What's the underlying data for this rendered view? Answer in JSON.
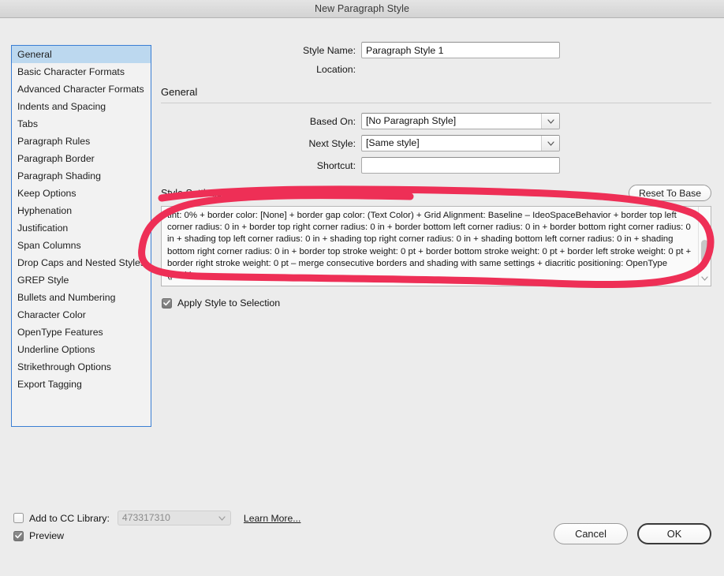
{
  "window": {
    "title": "New Paragraph Style"
  },
  "sidebar": {
    "items": [
      {
        "label": "General",
        "selected": true
      },
      {
        "label": "Basic Character Formats",
        "selected": false
      },
      {
        "label": "Advanced Character Formats",
        "selected": false
      },
      {
        "label": "Indents and Spacing",
        "selected": false
      },
      {
        "label": "Tabs",
        "selected": false
      },
      {
        "label": "Paragraph Rules",
        "selected": false
      },
      {
        "label": "Paragraph Border",
        "selected": false
      },
      {
        "label": "Paragraph Shading",
        "selected": false
      },
      {
        "label": "Keep Options",
        "selected": false
      },
      {
        "label": "Hyphenation",
        "selected": false
      },
      {
        "label": "Justification",
        "selected": false
      },
      {
        "label": "Span Columns",
        "selected": false
      },
      {
        "label": "Drop Caps and Nested Styles",
        "selected": false
      },
      {
        "label": "GREP Style",
        "selected": false
      },
      {
        "label": "Bullets and Numbering",
        "selected": false
      },
      {
        "label": "Character Color",
        "selected": false
      },
      {
        "label": "OpenType Features",
        "selected": false
      },
      {
        "label": "Underline Options",
        "selected": false
      },
      {
        "label": "Strikethrough Options",
        "selected": false
      },
      {
        "label": "Export Tagging",
        "selected": false
      }
    ]
  },
  "form": {
    "style_name_label": "Style Name:",
    "style_name_value": "Paragraph Style 1",
    "location_label": "Location:",
    "location_value": "",
    "section_heading": "General",
    "based_on_label": "Based On:",
    "based_on_value": "[No Paragraph Style]",
    "next_style_label": "Next Style:",
    "next_style_value": "[Same style]",
    "shortcut_label": "Shortcut:",
    "shortcut_value": ""
  },
  "style_settings": {
    "label": "Style Settings:",
    "reset_button": "Reset To Base",
    "text": "tint: 0% + border color: [None] + border gap color: (Text Color) + Grid Alignment:  Baseline – IdeoSpaceBehavior + border top left corner radius: 0 in + border top right corner radius: 0 in + border bottom left corner radius: 0 in + border bottom right corner radius: 0 in + shading top left corner radius: 0 in + shading top right corner radius: 0 in + shading bottom left corner radius: 0 in + shading bottom right corner radius: 0 in + border top stroke weight: 0 pt + border bottom stroke weight: 0 pt + border left stroke weight: 0 pt + border right stroke weight: 0 pt – merge consecutive borders and shading with same settings + diacritic positioning: OpenType (positive"
  },
  "apply_style": {
    "label": "Apply Style to Selection",
    "checked": true
  },
  "cc_library": {
    "label": "Add to CC Library:",
    "checked": false,
    "selected_value": "473317310",
    "learn_more": "Learn More..."
  },
  "preview": {
    "label": "Preview",
    "checked": true
  },
  "buttons": {
    "cancel": "Cancel",
    "ok": "OK"
  },
  "annotation": {
    "color": "#ee2f56",
    "shape": "hand-drawn-ellipse"
  }
}
